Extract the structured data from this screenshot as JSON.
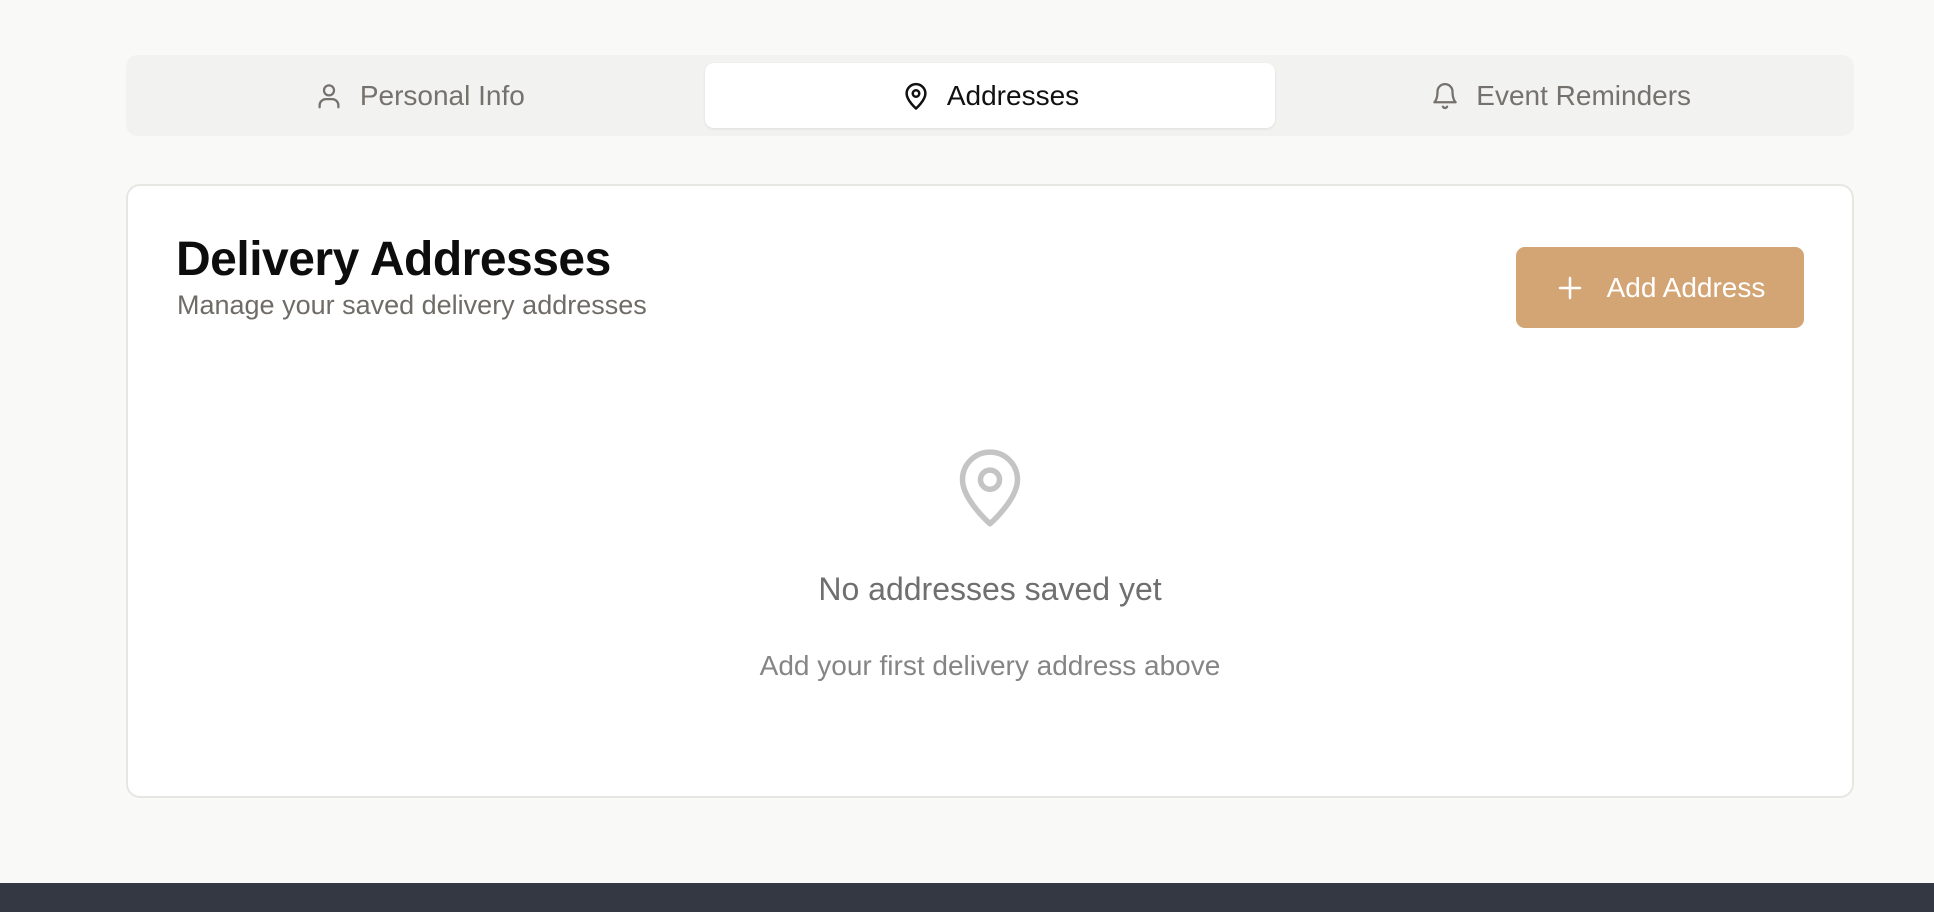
{
  "tabs": [
    {
      "label": "Personal Info",
      "icon": "user-icon",
      "active": false
    },
    {
      "label": "Addresses",
      "icon": "map-pin-icon",
      "active": true
    },
    {
      "label": "Event Reminders",
      "icon": "bell-icon",
      "active": false
    }
  ],
  "card": {
    "title": "Delivery Addresses",
    "subtitle": "Manage your saved delivery addresses",
    "add_button_label": "Add Address",
    "add_button_icon": "plus-icon"
  },
  "empty_state": {
    "icon": "map-pin-icon",
    "title": "No addresses saved yet",
    "subtitle": "Add your first delivery address above"
  },
  "colors": {
    "accent": "#d4a574",
    "background": "#f9f9f7",
    "footer": "#333842"
  }
}
